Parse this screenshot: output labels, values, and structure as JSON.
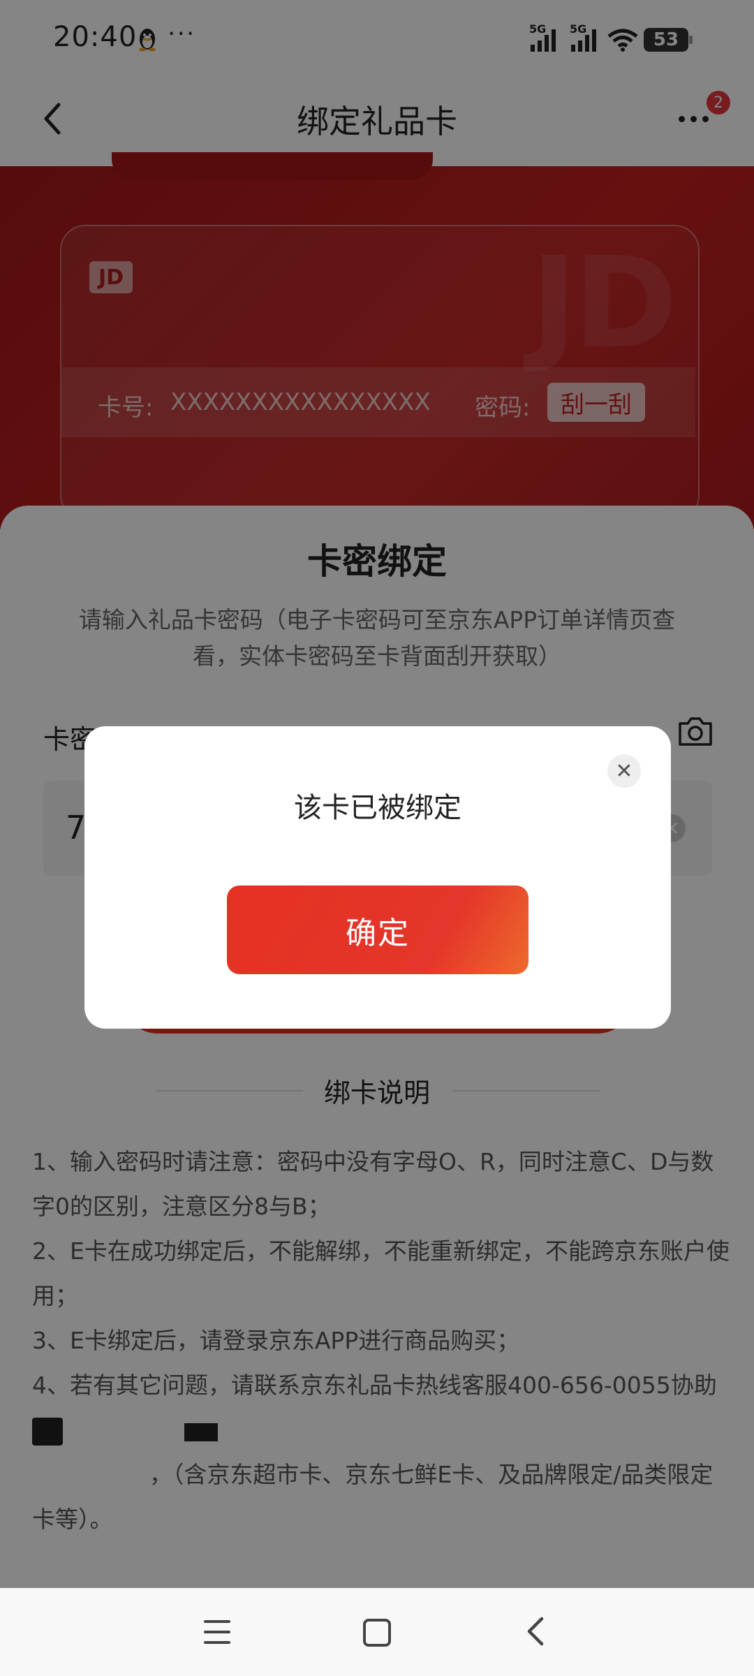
{
  "status_bar": {
    "time": "20:40",
    "more": "···",
    "signal1_label": "5G",
    "signal2_label": "5G",
    "battery": "53",
    "qq_icon": "qq-penguin-icon",
    "wifi_icon": "wifi-icon"
  },
  "nav": {
    "title": "绑定礼品卡",
    "back_icon": "chevron-left-icon",
    "more_icon": "more-dots-icon",
    "badge": "2"
  },
  "card": {
    "logo_small": "JD",
    "logo_big": "JD",
    "number_label": "卡号:",
    "number_value": "XXXXXXXXXXXXXXXX",
    "password_label": "密码:",
    "scratch_label": "刮一刮"
  },
  "sheet": {
    "title": "卡密绑定",
    "description": "请输入礼品卡密码（电子卡密码可至京东APP订单详情页查看，实体卡密码至卡背面刮开获取）",
    "field_label": "卡密",
    "input_value": "7",
    "camera_icon": "camera-icon",
    "clear_icon": "clear-icon"
  },
  "notes": {
    "title": "绑卡说明",
    "items": [
      "1、输入密码时请注意：密码中没有字母O、R，同时注意C、D与数字0的区别，注意区分8与B；",
      "2、E卡在成功绑定后，不能解绑，不能重新绑定，不能跨京东账户使用；",
      "3、E卡绑定后，请登录京东APP进行商品购买；",
      "4、若有其它问题，请联系京东礼品卡热线客服400-656-0055协助处",
      "                ，（含京东超市卡、京东七鲜E卡、及品牌限定/品类限定卡等）。"
    ]
  },
  "dialog": {
    "message": "该卡已被绑定",
    "confirm_label": "确定",
    "close_icon": "close-icon"
  },
  "system_nav": {
    "menu_icon": "menu-icon",
    "home_icon": "home-icon",
    "back_icon": "back-icon"
  },
  "colors": {
    "brand_red": "#e4393c",
    "banner_red": "#b51c1c",
    "confirm_gradient_start": "#e53123",
    "confirm_gradient_end": "#ee6a2c"
  }
}
